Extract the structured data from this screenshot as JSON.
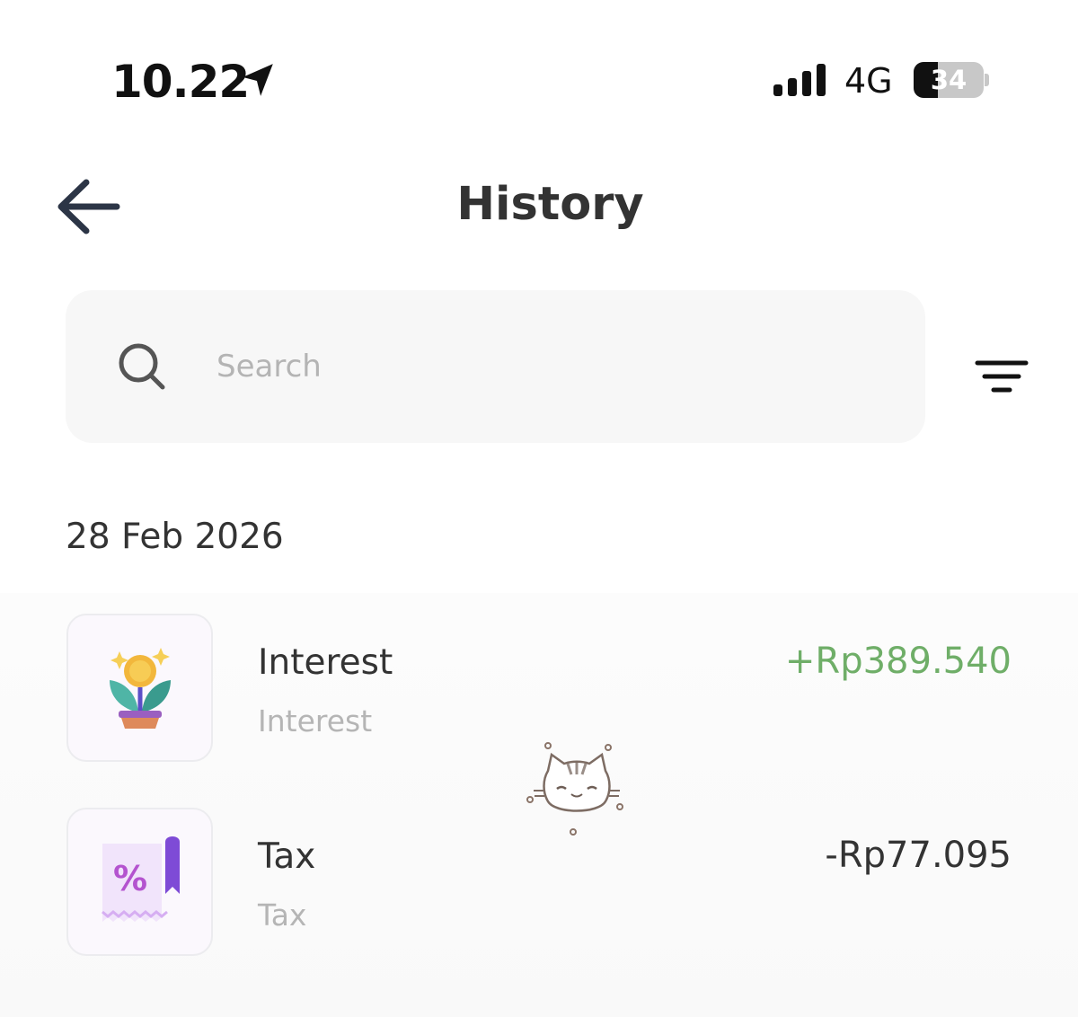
{
  "status_bar": {
    "time": "10.22",
    "network": "4G",
    "battery_level": "34",
    "battery_fraction": 0.34
  },
  "header": {
    "title": "History"
  },
  "search": {
    "placeholder": "Search",
    "value": ""
  },
  "history": {
    "date": "28 Feb 2026",
    "items": [
      {
        "title": "Interest",
        "subtitle": "Interest",
        "amount": "+Rp389.540",
        "amount_color": "#6fae68",
        "icon": "plant-coin-icon"
      },
      {
        "title": "Tax",
        "subtitle": "Tax",
        "amount": "-Rp77.095",
        "amount_color": "#333333",
        "icon": "tax-receipt-icon"
      }
    ]
  }
}
